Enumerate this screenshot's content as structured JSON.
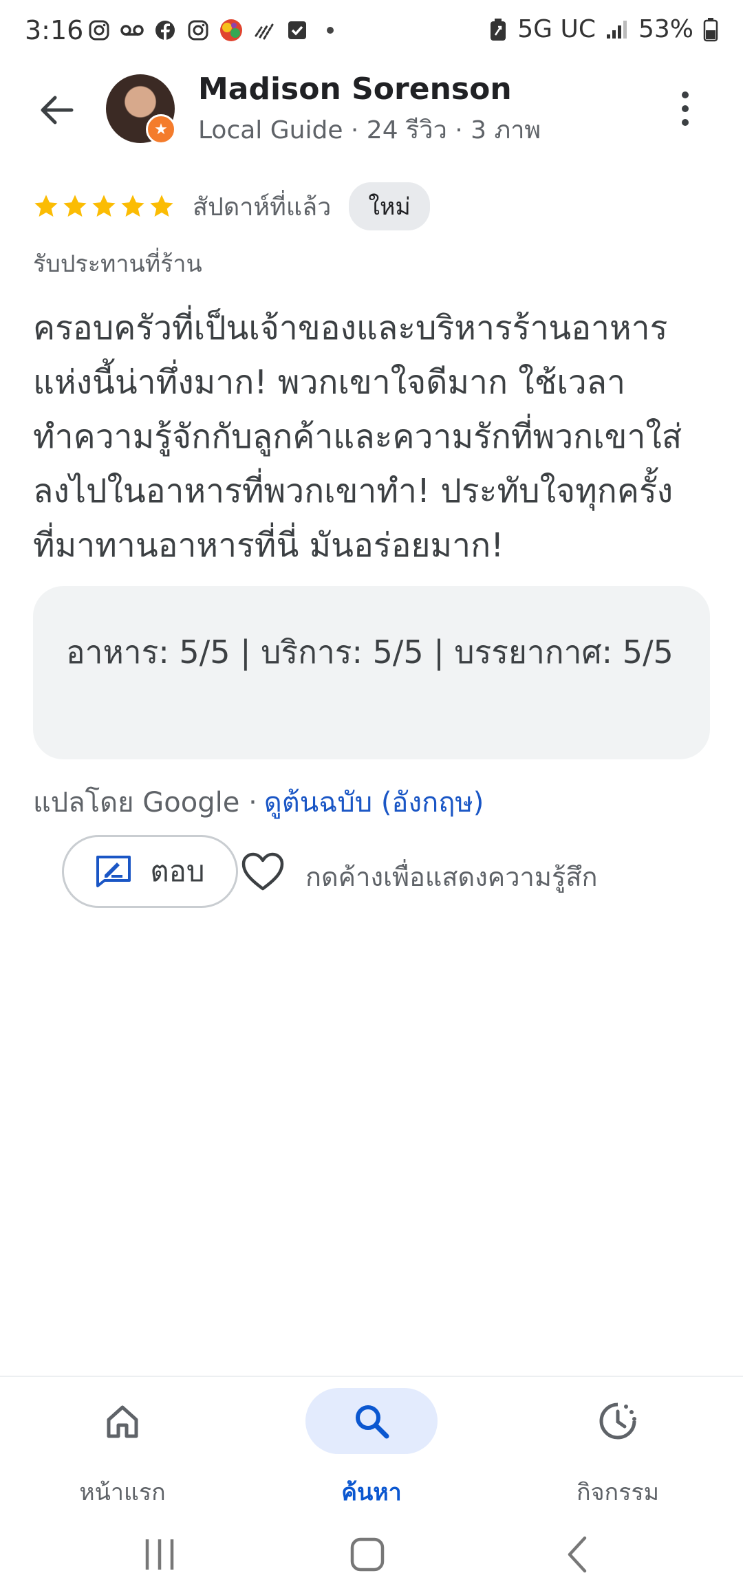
{
  "status_bar": {
    "time": "3:16",
    "network": "5G UC",
    "battery": "53%",
    "notification_icons": [
      "instagram-icon",
      "voicemail-icon",
      "facebook-icon",
      "instagram-icon",
      "game-app-icon",
      "signal-app-icon",
      "checkbox-app-icon"
    ]
  },
  "header": {
    "name": "Madison Sorenson",
    "meta": "Local Guide · 24 รีวิว · 3 ภาพ",
    "avatar_badge": "★"
  },
  "review": {
    "rating": 5,
    "when": "สัปดาห์ที่แล้ว",
    "new_badge": "ใหม่",
    "context": "รับประทานที่ร้าน",
    "text": "ครอบครัวที่เป็นเจ้าของและบริหารร้านอาหารแห่งนี้น่าทึ่งมาก! พวกเขาใจดีมาก ใช้เวลาทำความรู้จักกับลูกค้าและความรักที่พวกเขาใส่ลงไปในอาหารที่พวกเขาทำ! ประทับใจทุกครั้งที่มาทานอาหารที่นี่ มันอร่อยมาก!",
    "scores": "อาหาร: 5/5  |  บริการ: 5/5  |  บรรยากาศ: 5/5",
    "translated_by": "แปลโดย Google ·",
    "view_original": "ดูต้นฉบับ (อังกฤษ)"
  },
  "actions": {
    "reply_label": "ตอบ",
    "react_hint": "กดค้างเพื่อแสดงความรู้สึก"
  },
  "bottom_nav": {
    "items": [
      {
        "label": "หน้าแรก",
        "icon": "home-icon"
      },
      {
        "label": "ค้นหา",
        "icon": "search-icon",
        "active": true
      },
      {
        "label": "กิจกรรม",
        "icon": "activity-icon"
      }
    ]
  },
  "colors": {
    "accent": "#0b57d0",
    "star": "#fbbc04",
    "link": "#1a56c5"
  }
}
